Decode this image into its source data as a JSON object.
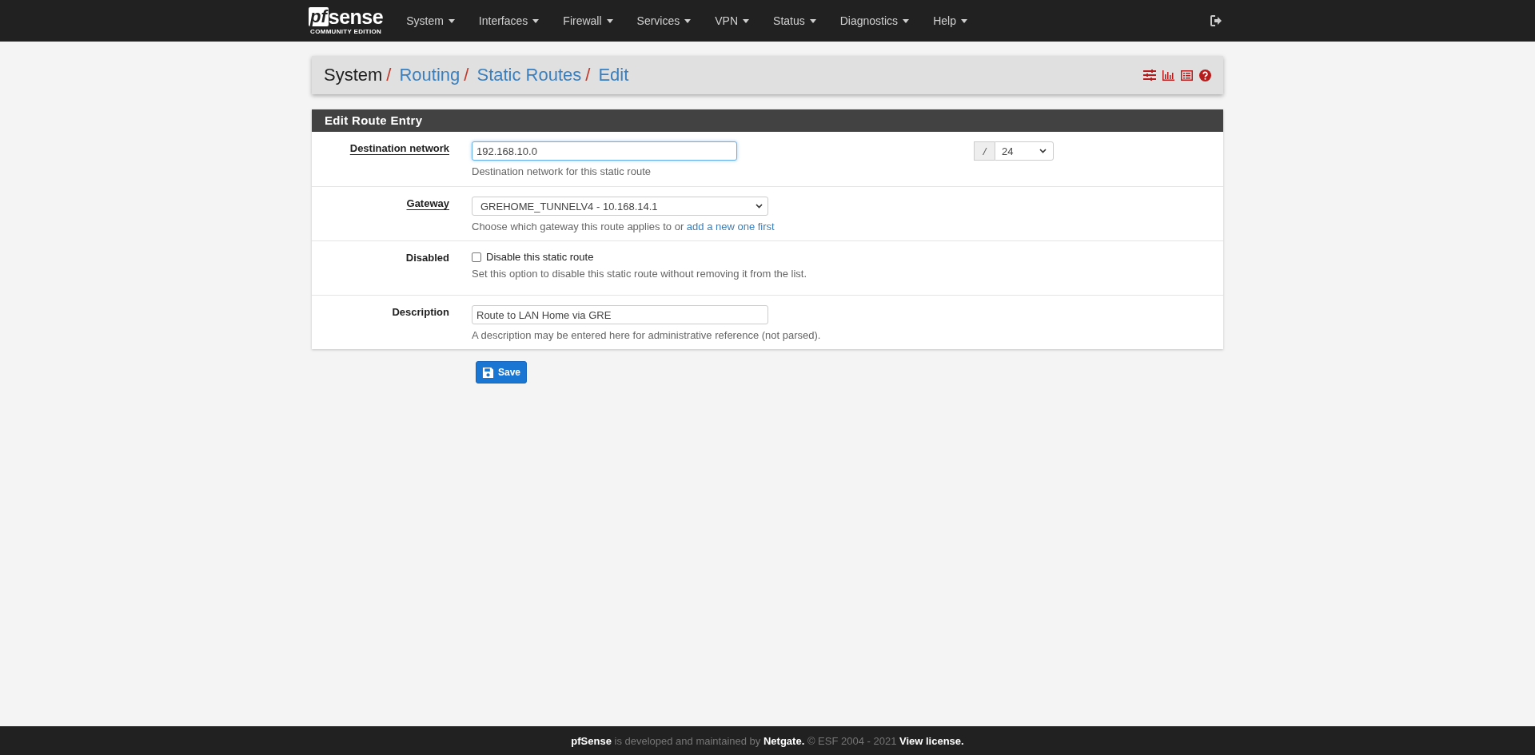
{
  "navbar": {
    "logo": {
      "brand": "sense",
      "brand_prefix": "pf",
      "edition": "COMMUNITY EDITION"
    },
    "menus": [
      {
        "label": "System"
      },
      {
        "label": "Interfaces"
      },
      {
        "label": "Firewall"
      },
      {
        "label": "Services"
      },
      {
        "label": "VPN"
      },
      {
        "label": "Status"
      },
      {
        "label": "Diagnostics"
      },
      {
        "label": "Help"
      }
    ]
  },
  "breadcrumb": [
    {
      "label": "System",
      "kind": "plain"
    },
    {
      "label": "Routing",
      "kind": "link"
    },
    {
      "label": "Static Routes",
      "kind": "link"
    },
    {
      "label": "Edit",
      "kind": "link"
    }
  ],
  "breadcrumb_separator": "/",
  "panel": {
    "title": "Edit Route Entry",
    "rows": [
      {
        "kind": "cidr",
        "label": "Destination network",
        "underlined": true,
        "value": "192.168.10.0",
        "separator": "/",
        "mask": "24",
        "hint": [
          {
            "text": "Destination network for this static route",
            "kind": "plain"
          }
        ]
      },
      {
        "kind": "select",
        "label": "Gateway",
        "underlined": true,
        "value": "GREHOME_TUNNELV4 - 10.168.14.1",
        "hint": [
          {
            "text": "Choose which gateway this route applies to or ",
            "kind": "plain"
          },
          {
            "text": "add a new one first",
            "kind": "link"
          }
        ]
      },
      {
        "kind": "checkbox",
        "label": "Disabled",
        "underlined": false,
        "checked": false,
        "option": "Disable this static route",
        "hint": [
          {
            "text": "Set this option to disable this static route without removing it from the list.",
            "kind": "plain"
          }
        ]
      },
      {
        "kind": "text",
        "label": "Description",
        "underlined": false,
        "value": "Route to LAN Home via GRE",
        "hint": [
          {
            "text": "A description may be entered here for administrative reference (not parsed).",
            "kind": "plain"
          }
        ]
      }
    ]
  },
  "save_button": {
    "label": "Save"
  },
  "footer": [
    {
      "text": "pfSense",
      "kind": "link"
    },
    {
      "text": " is developed and maintained by ",
      "kind": "plain"
    },
    {
      "text": "Netgate.",
      "kind": "link"
    },
    {
      "text": " © ESF 2004 - 2021 ",
      "kind": "plain"
    },
    {
      "text": "View license.",
      "kind": "link"
    }
  ]
}
